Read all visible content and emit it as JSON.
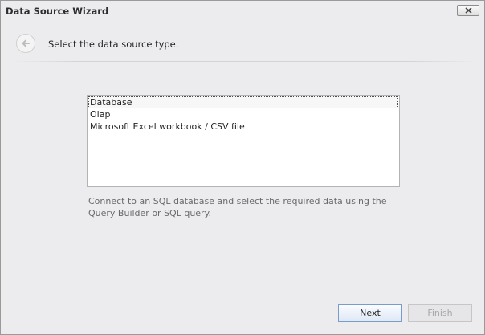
{
  "window": {
    "title": "Data Source Wizard"
  },
  "header": {
    "instruction": "Select the data source type."
  },
  "source_types": {
    "items": [
      {
        "label": "Database",
        "selected": true
      },
      {
        "label": "Olap",
        "selected": false
      },
      {
        "label": "Microsoft Excel workbook / CSV file",
        "selected": false
      }
    ]
  },
  "description": "Connect to an SQL database and select the required data using the Query Builder or SQL query.",
  "footer": {
    "next_label": "Next",
    "finish_label": "Finish",
    "finish_enabled": false
  },
  "colors": {
    "window_bg": "#ececee",
    "next_border": "#7a9cc8",
    "disabled_text": "#a6a6a6"
  },
  "icons": {
    "close": "close-icon",
    "back": "arrow-left-icon"
  }
}
